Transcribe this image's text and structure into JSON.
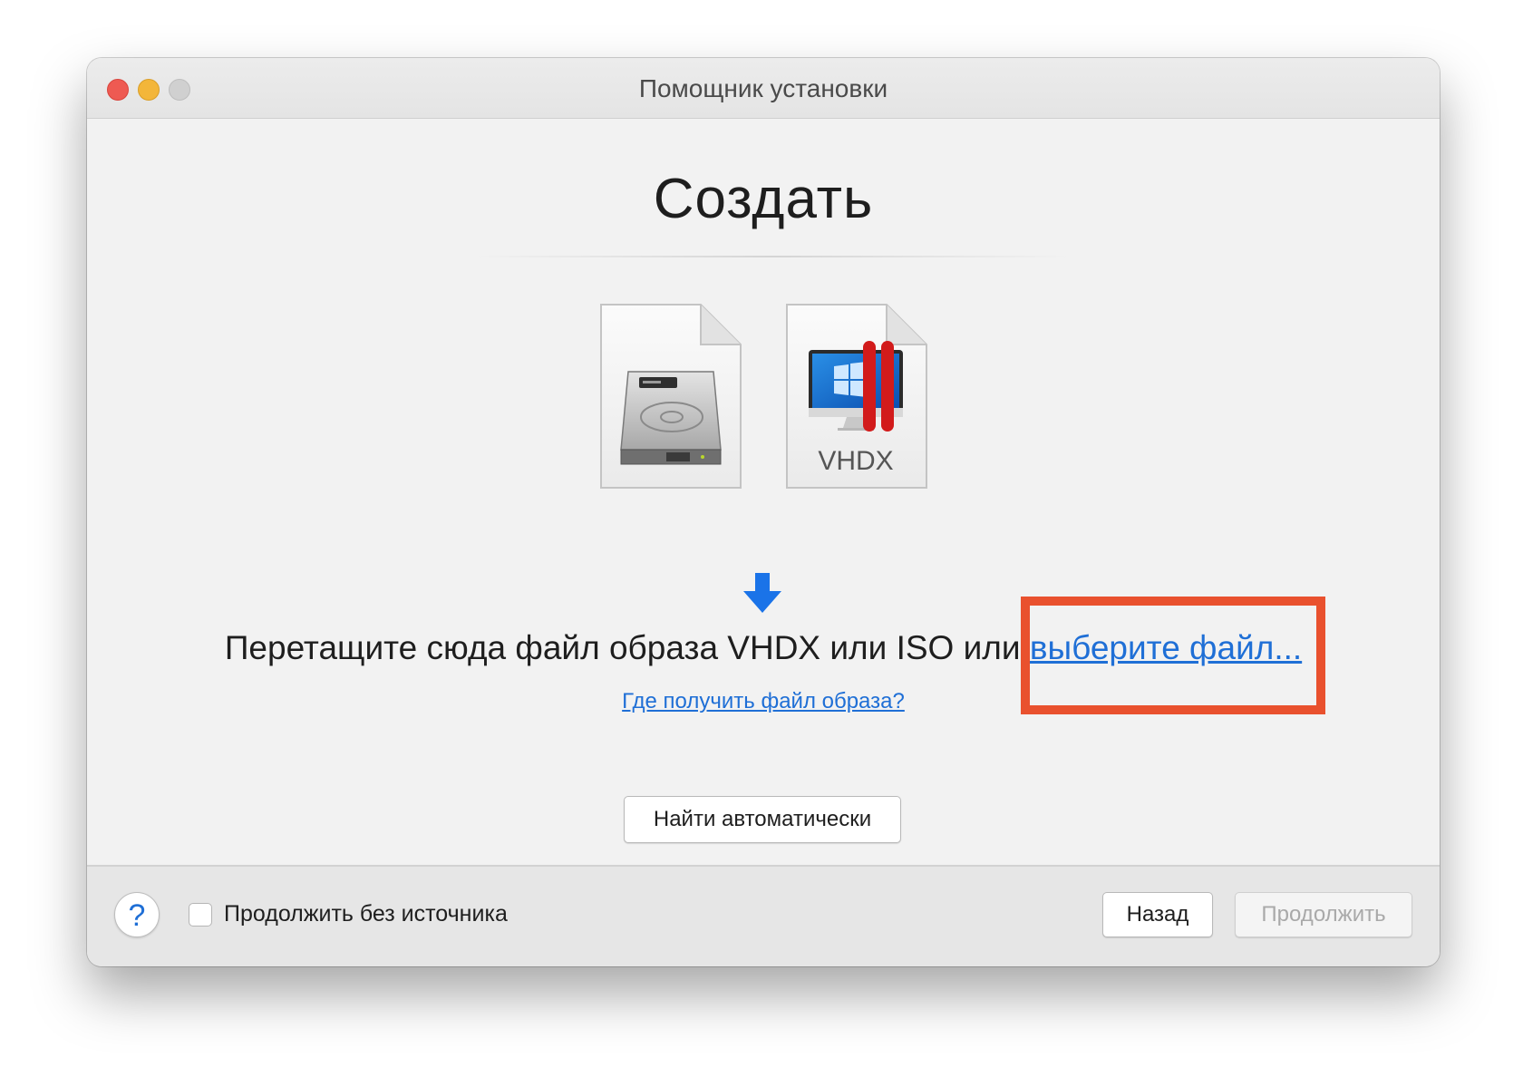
{
  "window": {
    "title": "Помощник установки"
  },
  "main": {
    "heading": "Создать",
    "doc_label": "VHDX",
    "instruction_text": "Перетащите сюда файл образа VHDX или ISO или ",
    "choose_link": "выберите файл...",
    "help_link": "Где получить файл образа?",
    "auto_button": "Найти автоматически"
  },
  "footer": {
    "help_icon": "?",
    "checkbox_label": "Продолжить без источника",
    "checkbox_checked": false,
    "back_button": "Назад",
    "continue_button": "Продолжить"
  },
  "colors": {
    "link": "#1f6fd6",
    "highlight": "#e9512e",
    "arrow": "#1a73e8",
    "close": "#ee5a52",
    "minimize": "#f3b63a"
  },
  "icons": {
    "drag_arrow": "arrow-down-icon",
    "hdd_document": "hard-drive-document-icon",
    "vhdx_document": "vhdx-document-icon"
  }
}
